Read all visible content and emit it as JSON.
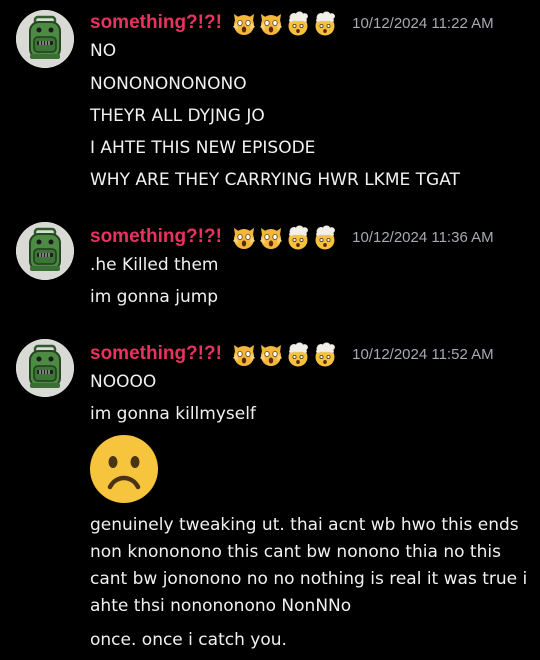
{
  "messages": [
    {
      "username": "something?!?!",
      "timestamp": "10/12/2024 11:22 AM",
      "lines": [
        "NO",
        "NONONONONONO",
        "THEYR ALL DYJNG JO",
        "I AHTE THIS NEW EPISODE",
        "WHY ARE THEY CARRYING HWR LKME TGAT"
      ]
    },
    {
      "username": "something?!?!",
      "timestamp": "10/12/2024 11:36 AM",
      "lines": [
        ".he Killed them",
        "im gonna jump"
      ]
    },
    {
      "username": "something?!?!",
      "timestamp": "10/12/2024 11:52 AM",
      "lines": [
        "NOOOO",
        "im gonna killmyself",
        "genuinely tweaking ut. thai acnt wb hwo this ends non knononono this cant bw nonono thia no this cant bw jononono no no nothing is real it was true i ahte thsi nonononono NonNNo",
        "once. once i catch you."
      ]
    }
  ],
  "icons": {
    "avatar": "green-backpack-avatar",
    "name_emojis": [
      "scream-cat-emoji",
      "scream-cat-emoji",
      "exploding-head-emoji",
      "exploding-head-emoji"
    ],
    "reaction": "frowning-face-emoji"
  },
  "colors": {
    "background": "#000000",
    "username": "#e8335f",
    "timestamp": "#a7a9b1",
    "text": "#f1f1f3",
    "avatar_green": "#3f7a3a"
  }
}
